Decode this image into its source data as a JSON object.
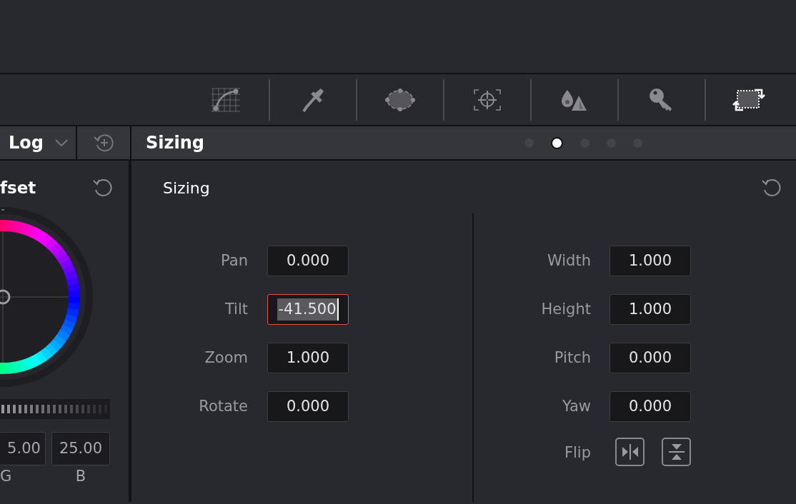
{
  "toolbar": {
    "tools": [
      {
        "kind": "curves",
        "selected": false
      },
      {
        "kind": "qualifier",
        "selected": false
      },
      {
        "kind": "window",
        "selected": false
      },
      {
        "kind": "tracker",
        "selected": false
      },
      {
        "kind": "blur",
        "selected": false
      },
      {
        "kind": "key",
        "selected": false
      },
      {
        "kind": "sizing",
        "selected": true
      }
    ]
  },
  "left_panel": {
    "mode_label": "Log",
    "wheel_title": "fset",
    "wheel_values": [
      {
        "label": "G",
        "value": "5.00"
      },
      {
        "label": "B",
        "value": "25.00"
      }
    ]
  },
  "sizing_panel": {
    "header": "Sizing",
    "pages": [
      {
        "selected": false
      },
      {
        "selected": true
      },
      {
        "selected": false
      },
      {
        "selected": false
      },
      {
        "selected": false
      }
    ],
    "section_title": "Sizing",
    "left_fields": [
      {
        "label": "Pan",
        "value": "0.000",
        "focused": false
      },
      {
        "label": "Tilt",
        "value": "-41.500",
        "focused": true
      },
      {
        "label": "Zoom",
        "value": "1.000",
        "focused": false
      },
      {
        "label": "Rotate",
        "value": "0.000",
        "focused": false
      }
    ],
    "right_fields": [
      {
        "label": "Width",
        "value": "1.000",
        "focused": false
      },
      {
        "label": "Height",
        "value": "1.000",
        "focused": false
      },
      {
        "label": "Pitch",
        "value": "0.000",
        "focused": false
      },
      {
        "label": "Yaw",
        "value": "0.000",
        "focused": false
      }
    ],
    "flip": {
      "label": "Flip",
      "buttons": [
        {
          "kind": "horizontal"
        },
        {
          "kind": "vertical"
        }
      ]
    }
  }
}
